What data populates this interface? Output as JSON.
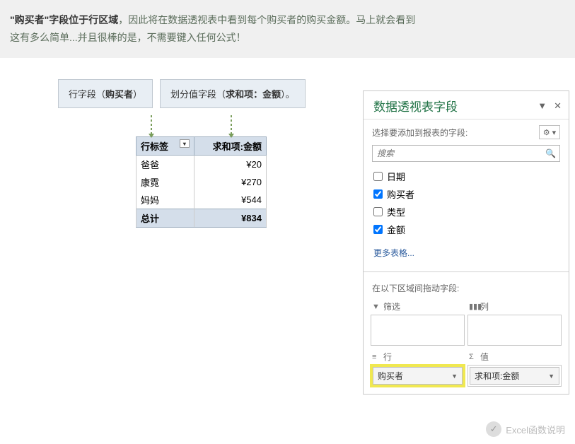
{
  "intro": {
    "highlight": "\"购买者\"字段位于行区域",
    "rest1": "，因此将在数据透视表中看到每个购买者的购买金额。马上就会看到",
    "rest2": "这有多么简单...并且很棒的是，不需要键入任何公式！"
  },
  "labels": {
    "row_field_prefix": "行字段（",
    "row_field_bold": "购买者",
    "row_field_suffix": "）",
    "value_field_prefix": "划分值字段（",
    "value_field_bold": "求和项：金额",
    "value_field_suffix": "）。"
  },
  "pivot": {
    "header1": "行标签",
    "header2": "求和项:金额",
    "rows": [
      {
        "label": "爸爸",
        "value": "¥20"
      },
      {
        "label": "康霓",
        "value": "¥270"
      },
      {
        "label": "妈妈",
        "value": "¥544"
      }
    ],
    "total_label": "总计",
    "total_value": "¥834"
  },
  "pane": {
    "title": "数据透视表字段",
    "subtitle": "选择要添加到报表的字段:",
    "search_placeholder": "搜索",
    "fields": [
      {
        "label": "日期",
        "checked": false
      },
      {
        "label": "购买者",
        "checked": true
      },
      {
        "label": "类型",
        "checked": false
      },
      {
        "label": "金额",
        "checked": true
      }
    ],
    "more_tables": "更多表格...",
    "drag_label": "在以下区域间拖动字段:",
    "areas": {
      "filters": "筛选",
      "columns": "列",
      "rows": "行",
      "values": "值"
    },
    "row_chip": "购买者",
    "value_chip": "求和项:金额"
  },
  "watermark": {
    "text": "Excel函数说明"
  }
}
